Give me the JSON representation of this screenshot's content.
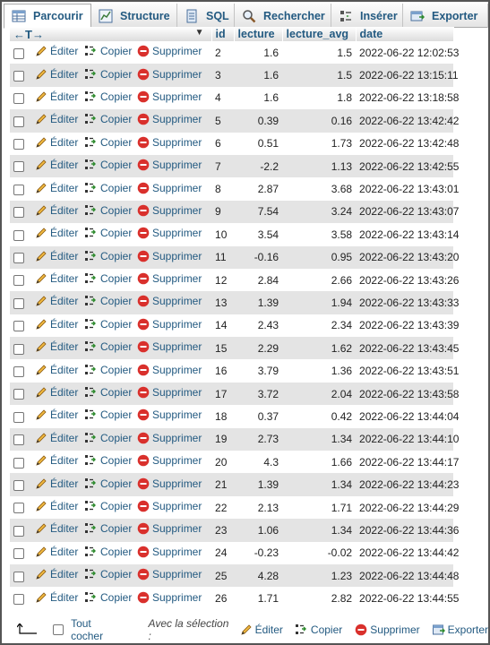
{
  "tabs": [
    {
      "label": "Parcourir",
      "icon": "browse-icon"
    },
    {
      "label": "Structure",
      "icon": "structure-icon"
    },
    {
      "label": "SQL",
      "icon": "sql-icon"
    },
    {
      "label": "Rechercher",
      "icon": "search-icon"
    },
    {
      "label": "Insérer",
      "icon": "insert-icon"
    },
    {
      "label": "Exporter",
      "icon": "export-icon"
    }
  ],
  "table": {
    "nav_arrows": "←T→",
    "columns": [
      "id",
      "lecture",
      "lecture_avg",
      "date"
    ],
    "actions": {
      "edit": "Éditer",
      "copy": "Copier",
      "delete": "Supprimer"
    },
    "rows": [
      {
        "id": "2",
        "lecture": "1.6",
        "lecture_avg": "1.5",
        "date": "2022-06-22 12:02:53"
      },
      {
        "id": "3",
        "lecture": "1.6",
        "lecture_avg": "1.5",
        "date": "2022-06-22 13:15:11"
      },
      {
        "id": "4",
        "lecture": "1.6",
        "lecture_avg": "1.8",
        "date": "2022-06-22 13:18:58"
      },
      {
        "id": "5",
        "lecture": "0.39",
        "lecture_avg": "0.16",
        "date": "2022-06-22 13:42:42"
      },
      {
        "id": "6",
        "lecture": "0.51",
        "lecture_avg": "1.73",
        "date": "2022-06-22 13:42:48"
      },
      {
        "id": "7",
        "lecture": "-2.2",
        "lecture_avg": "1.13",
        "date": "2022-06-22 13:42:55"
      },
      {
        "id": "8",
        "lecture": "2.87",
        "lecture_avg": "3.68",
        "date": "2022-06-22 13:43:01"
      },
      {
        "id": "9",
        "lecture": "7.54",
        "lecture_avg": "3.24",
        "date": "2022-06-22 13:43:07"
      },
      {
        "id": "10",
        "lecture": "3.54",
        "lecture_avg": "3.58",
        "date": "2022-06-22 13:43:14"
      },
      {
        "id": "11",
        "lecture": "-0.16",
        "lecture_avg": "0.95",
        "date": "2022-06-22 13:43:20"
      },
      {
        "id": "12",
        "lecture": "2.84",
        "lecture_avg": "2.66",
        "date": "2022-06-22 13:43:26"
      },
      {
        "id": "13",
        "lecture": "1.39",
        "lecture_avg": "1.94",
        "date": "2022-06-22 13:43:33"
      },
      {
        "id": "14",
        "lecture": "2.43",
        "lecture_avg": "2.34",
        "date": "2022-06-22 13:43:39"
      },
      {
        "id": "15",
        "lecture": "2.29",
        "lecture_avg": "1.62",
        "date": "2022-06-22 13:43:45"
      },
      {
        "id": "16",
        "lecture": "3.79",
        "lecture_avg": "1.36",
        "date": "2022-06-22 13:43:51"
      },
      {
        "id": "17",
        "lecture": "3.72",
        "lecture_avg": "2.04",
        "date": "2022-06-22 13:43:58"
      },
      {
        "id": "18",
        "lecture": "0.37",
        "lecture_avg": "0.42",
        "date": "2022-06-22 13:44:04"
      },
      {
        "id": "19",
        "lecture": "2.73",
        "lecture_avg": "1.34",
        "date": "2022-06-22 13:44:10"
      },
      {
        "id": "20",
        "lecture": "4.3",
        "lecture_avg": "1.66",
        "date": "2022-06-22 13:44:17"
      },
      {
        "id": "21",
        "lecture": "1.39",
        "lecture_avg": "1.34",
        "date": "2022-06-22 13:44:23"
      },
      {
        "id": "22",
        "lecture": "2.13",
        "lecture_avg": "1.71",
        "date": "2022-06-22 13:44:29"
      },
      {
        "id": "23",
        "lecture": "1.06",
        "lecture_avg": "1.34",
        "date": "2022-06-22 13:44:36"
      },
      {
        "id": "24",
        "lecture": "-0.23",
        "lecture_avg": "-0.02",
        "date": "2022-06-22 13:44:42"
      },
      {
        "id": "25",
        "lecture": "4.28",
        "lecture_avg": "1.23",
        "date": "2022-06-22 13:44:48"
      },
      {
        "id": "26",
        "lecture": "1.71",
        "lecture_avg": "2.82",
        "date": "2022-06-22 13:44:55"
      }
    ]
  },
  "footer": {
    "check_all": "Tout cocher",
    "with_selection": "Avec la sélection :",
    "edit": "Éditer",
    "copy": "Copier",
    "delete": "Supprimer",
    "export": "Exporter"
  },
  "colors": {
    "link": "#235a81",
    "row_alt": "#e4e4e4",
    "delete_red": "#d9302c",
    "pencil": "#e8a317"
  }
}
